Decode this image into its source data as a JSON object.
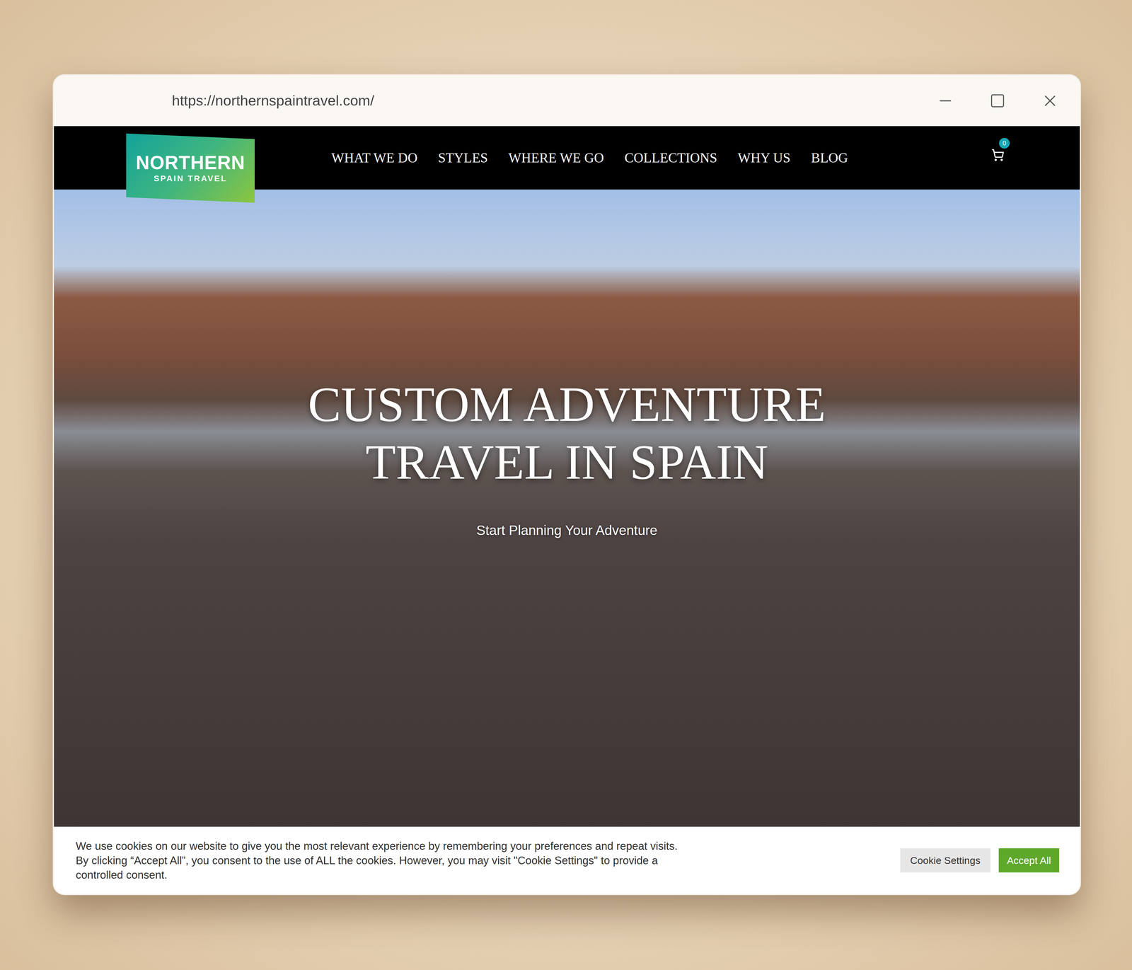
{
  "browser": {
    "url": "https://northernspaintravel.com/"
  },
  "logo": {
    "name": "NORTHERN",
    "tagline": "SPAIN TRAVEL"
  },
  "nav": {
    "items": [
      {
        "label": "WHAT WE DO"
      },
      {
        "label": "STYLES"
      },
      {
        "label": "WHERE WE GO"
      },
      {
        "label": "COLLECTIONS"
      },
      {
        "label": "WHY US"
      },
      {
        "label": "BLOG"
      }
    ]
  },
  "cart": {
    "count": "0"
  },
  "hero": {
    "title_lines": [
      "CUSTOM ADVENTURE",
      "TRAVEL IN SPAIN"
    ],
    "cta": "Start Planning Your Adventure"
  },
  "cookie_banner": {
    "lines": [
      "We use cookies on our website to give you the most relevant experience by remembering your preferences and repeat visits.",
      "By clicking “Accept All”, you consent to the use of ALL the cookies. However, you may visit \"Cookie Settings\" to provide a",
      "controlled consent."
    ],
    "buttons": [
      {
        "label": "Cookie Settings",
        "kind": "secondary"
      },
      {
        "label": "Accept All",
        "kind": "primary"
      }
    ]
  }
}
